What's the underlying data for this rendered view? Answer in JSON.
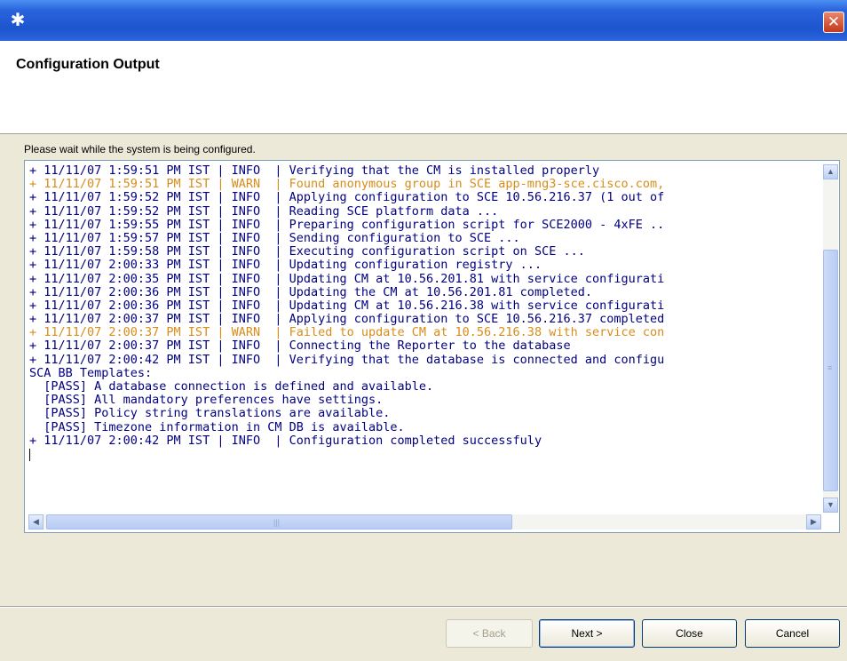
{
  "window": {
    "icon": "eclipse-wizard-icon",
    "close_glyph": "✕"
  },
  "header": {
    "title": "Configuration Output"
  },
  "status_text": "Please wait while the system is being configured.",
  "log": {
    "lines": [
      {
        "text": "+ 11/11/07 1:59:51 PM IST | INFO  | Verifying that the CM is installed properly",
        "level": "info"
      },
      {
        "text": "+ 11/11/07 1:59:51 PM IST | WARN  | Found anonymous group in SCE app-mng3-sce.cisco.com,",
        "level": "warn"
      },
      {
        "text": "+ 11/11/07 1:59:52 PM IST | INFO  | Applying configuration to SCE 10.56.216.37 (1 out of",
        "level": "info"
      },
      {
        "text": "+ 11/11/07 1:59:52 PM IST | INFO  | Reading SCE platform data ...",
        "level": "info"
      },
      {
        "text": "+ 11/11/07 1:59:55 PM IST | INFO  | Preparing configuration script for SCE2000 - 4xFE ..",
        "level": "info"
      },
      {
        "text": "+ 11/11/07 1:59:57 PM IST | INFO  | Sending configuration to SCE ...",
        "level": "info"
      },
      {
        "text": "+ 11/11/07 1:59:58 PM IST | INFO  | Executing configuration script on SCE ...",
        "level": "info"
      },
      {
        "text": "+ 11/11/07 2:00:33 PM IST | INFO  | Updating configuration registry ...",
        "level": "info"
      },
      {
        "text": "+ 11/11/07 2:00:35 PM IST | INFO  | Updating CM at 10.56.201.81 with service configurati",
        "level": "info"
      },
      {
        "text": "+ 11/11/07 2:00:36 PM IST | INFO  | Updating the CM at 10.56.201.81 completed.",
        "level": "info"
      },
      {
        "text": "+ 11/11/07 2:00:36 PM IST | INFO  | Updating CM at 10.56.216.38 with service configurati",
        "level": "info"
      },
      {
        "text": "+ 11/11/07 2:00:37 PM IST | INFO  | Applying configuration to SCE 10.56.216.37 completed",
        "level": "info"
      },
      {
        "text": "+ 11/11/07 2:00:37 PM IST | WARN  | Failed to update CM at 10.56.216.38 with service con",
        "level": "warn"
      },
      {
        "text": "+ 11/11/07 2:00:37 PM IST | INFO  | Connecting the Reporter to the database",
        "level": "info"
      },
      {
        "text": "+ 11/11/07 2:00:42 PM IST | INFO  | Verifying that the database is connected and configu",
        "level": "info"
      },
      {
        "text": "SCA BB Templates:",
        "level": "info"
      },
      {
        "text": "  [PASS] A database connection is defined and available.",
        "level": "info"
      },
      {
        "text": "  [PASS] All mandatory preferences have settings.",
        "level": "info"
      },
      {
        "text": "  [PASS] Policy string translations are available.",
        "level": "info"
      },
      {
        "text": "  [PASS] Timezone information in CM DB is available.",
        "level": "info"
      },
      {
        "text": "+ 11/11/07 2:00:42 PM IST | INFO  | Configuration completed successfuly",
        "level": "info"
      }
    ]
  },
  "scrollbars": {
    "up_glyph": "▲",
    "down_glyph": "▼",
    "left_glyph": "◀",
    "right_glyph": "▶"
  },
  "buttons": {
    "back": "< Back",
    "next": "Next >",
    "close": "Close",
    "cancel": "Cancel"
  },
  "colors": {
    "log_text": "#000080",
    "warn_text": "#d98c1a",
    "title_bar": "#2a64dc"
  }
}
